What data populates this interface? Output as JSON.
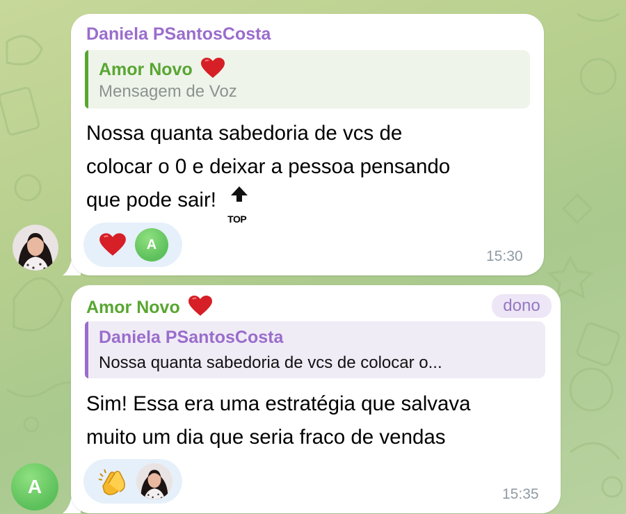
{
  "messages": [
    {
      "sender": "Daniela PSantosCosta",
      "reply": {
        "author": "Amor Novo",
        "preview": "Mensagem de Voz"
      },
      "text_lines": [
        "Nossa quanta sabedoria de vcs de",
        "colocar o 0 e deixar a pessoa pensando",
        "que pode sair!"
      ],
      "top_emoji_label": "TOP",
      "reactions": [
        "red-heart",
        "user-A"
      ],
      "reaction_avatar_letter": "A",
      "time": "15:30"
    },
    {
      "sender": "Amor Novo",
      "badge": "dono",
      "reply": {
        "author": "Daniela PSantosCosta",
        "preview": "Nossa quanta sabedoria de vcs de colocar o..."
      },
      "text_lines": [
        "Sim! Essa era uma estratégia que salvava",
        "muito um dia que seria fraco de vendas"
      ],
      "reactions": [
        "clapping-hands",
        "user-photo"
      ],
      "time": "15:35"
    }
  ],
  "sidebar_avatar_letter": "A",
  "colors": {
    "purple_name": "#9a6dcc",
    "green_name": "#58a632",
    "green_reply_bg": "#eef4ea",
    "purple_reply_bg": "#f0ecf6",
    "reaction_bg": "#e6f0fa",
    "time": "#8f9aa3"
  }
}
